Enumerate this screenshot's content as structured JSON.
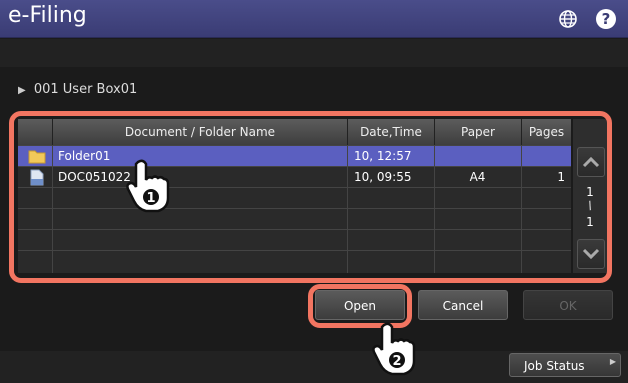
{
  "app": {
    "title": "e-Filing"
  },
  "icons": {
    "globe": "globe-icon",
    "help": "help-icon",
    "help_glyph": "?"
  },
  "breadcrumb": {
    "marker": "▶",
    "text": "001 User Box01"
  },
  "table": {
    "columns": [
      "Document / Folder Name",
      "Date,Time",
      "Paper",
      "Pages"
    ],
    "rows": [
      {
        "icon": "folder-icon",
        "name": "Folder01",
        "date": "10, 12:57",
        "paper": "",
        "pages": "",
        "selected": true
      },
      {
        "icon": "document-icon",
        "name": "DOC051022",
        "date": "10, 09:55",
        "paper": "A4",
        "pages": "1",
        "selected": false
      }
    ],
    "empty_rows": 4
  },
  "pager": {
    "current": "1",
    "separator": "/",
    "total": "1"
  },
  "buttons": {
    "open": "Open",
    "cancel": "Cancel",
    "ok": "OK"
  },
  "footer": {
    "job_status": "Job Status",
    "marker": "▶"
  },
  "callouts": {
    "step1": "1",
    "step2": "2"
  },
  "colors": {
    "accent": "#5b5fc0",
    "titlebar": "#3a3c74",
    "callout": "#f27561"
  }
}
